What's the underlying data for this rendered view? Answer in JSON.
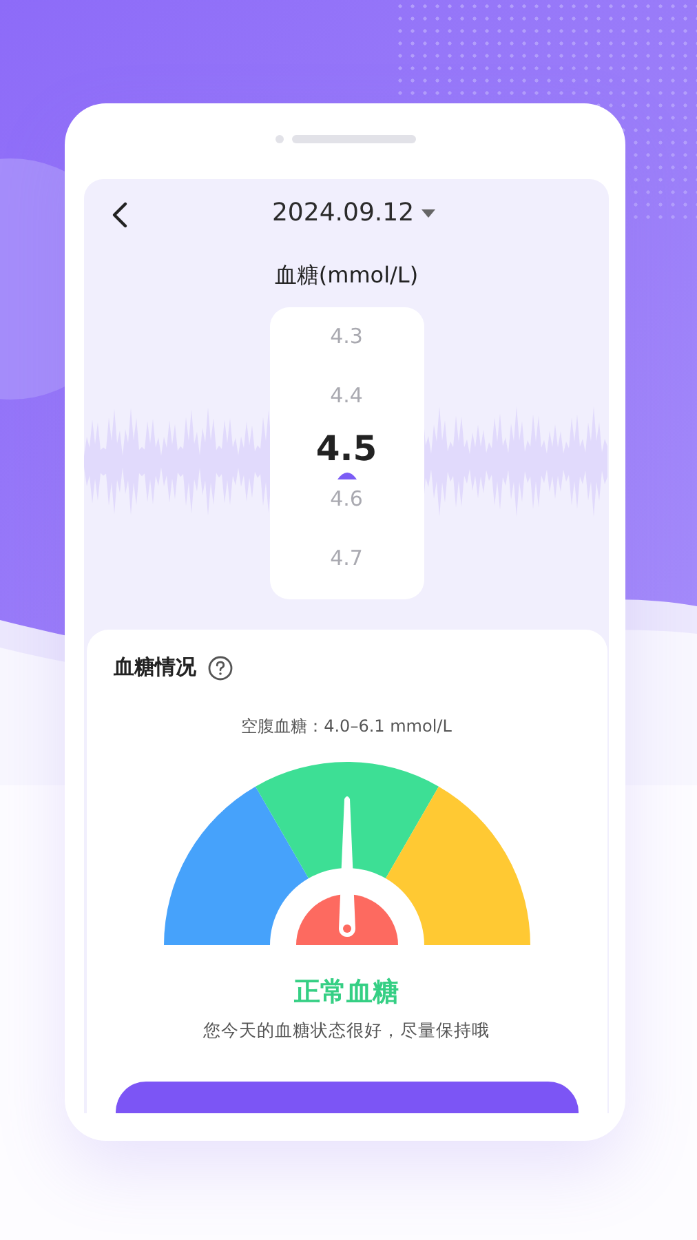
{
  "header": {
    "date": "2024.09.12"
  },
  "picker": {
    "label": "血糖(mmol/L)",
    "values": [
      {
        "text": "4.3",
        "selected": false
      },
      {
        "text": "4.4",
        "selected": false
      },
      {
        "text": "4.5",
        "selected": true
      },
      {
        "text": "4.6",
        "selected": false
      },
      {
        "text": "4.7",
        "selected": false
      }
    ]
  },
  "situation": {
    "title": "血糖情况",
    "range": "空腹血糖：4.0–6.1 mmol/L",
    "gauge": {
      "segments": [
        {
          "color": "#46a2fb"
        },
        {
          "color": "#3ddf95"
        },
        {
          "color": "#ffc933"
        }
      ]
    },
    "status": "正常血糖",
    "message": "您今天的血糖状态很好，尽量保持哦"
  }
}
